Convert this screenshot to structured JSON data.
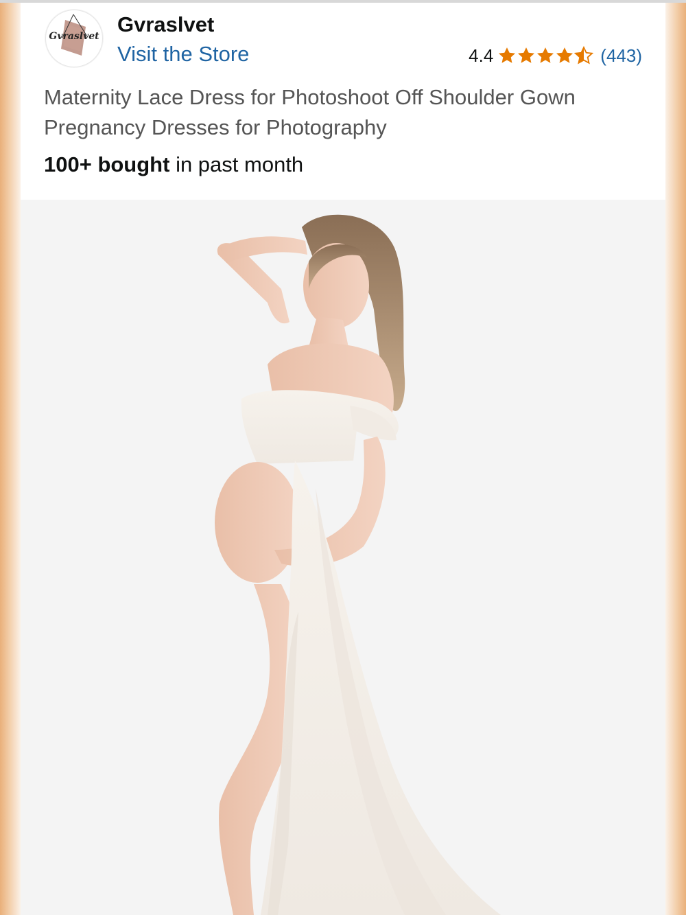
{
  "seller": {
    "logo_text": "Gvraslvet",
    "brand_name": "Gvraslvet",
    "visit_store_label": "Visit the Store"
  },
  "rating": {
    "value": "4.4",
    "stars": 4.4,
    "star_color": "#e67a00",
    "count": "(443)"
  },
  "product": {
    "title": "Maternity Lace Dress for Photoshoot Off Shoulder Gown Pregnancy Dresses for Photography",
    "bought_bold": "100+ bought",
    "bought_rest": " in past month"
  },
  "colors": {
    "link": "#1f64a3",
    "text_dark": "#0f1111",
    "text_muted": "#555555"
  }
}
